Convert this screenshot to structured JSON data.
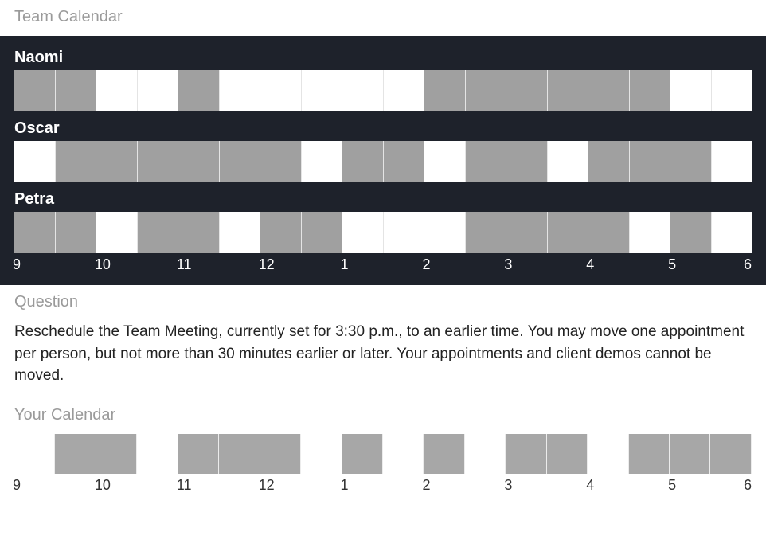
{
  "team_calendar_title": "Team Calendar",
  "question_title": "Question",
  "question_body": "Reschedule the Team Meeting, currently set for 3:30 p.m., to an earlier time. You may move one appointment per person, but not more than 30 minutes earlier or later. Your appointments and client demos cannot be moved.",
  "your_calendar_title": "Your Calendar",
  "hour_labels": [
    "9",
    "10",
    "11",
    "12",
    "1",
    "2",
    "3",
    "4",
    "5",
    "6"
  ],
  "people": [
    {
      "name": "Naomi",
      "slots": [
        1,
        1,
        0,
        0,
        1,
        0,
        0,
        0,
        0,
        0,
        1,
        1,
        1,
        1,
        1,
        1,
        0,
        0
      ]
    },
    {
      "name": "Oscar",
      "slots": [
        0,
        1,
        1,
        1,
        1,
        1,
        1,
        0,
        1,
        1,
        0,
        1,
        1,
        0,
        1,
        1,
        1,
        0
      ]
    },
    {
      "name": "Petra",
      "slots": [
        1,
        1,
        0,
        1,
        1,
        0,
        1,
        1,
        0,
        0,
        0,
        1,
        1,
        1,
        1,
        0,
        1,
        0
      ]
    }
  ],
  "your_slots": [
    0,
    1,
    1,
    0,
    1,
    1,
    1,
    0,
    1,
    0,
    1,
    0,
    1,
    1,
    0,
    1,
    1,
    1
  ]
}
